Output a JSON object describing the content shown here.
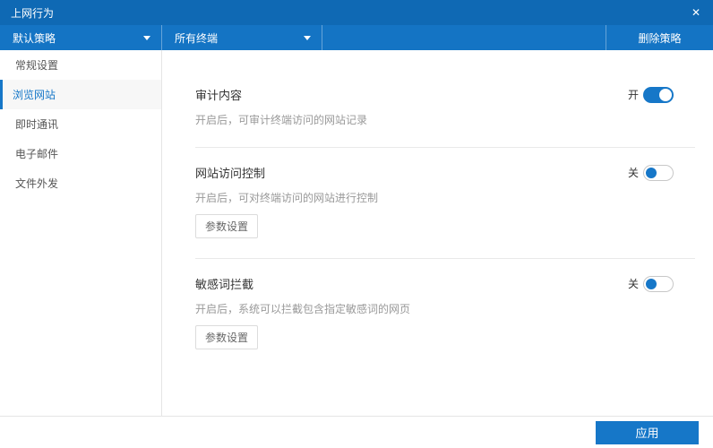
{
  "window": {
    "title": "上网行为",
    "close_icon": "✕"
  },
  "toolbar": {
    "policy_dropdown": {
      "value": "默认策略"
    },
    "terminal_dropdown": {
      "value": "所有终端"
    },
    "delete_button_label": "删除策略"
  },
  "sidebar": {
    "items": [
      {
        "label": "常规设置",
        "selected": false
      },
      {
        "label": "浏览网站",
        "selected": true
      },
      {
        "label": "即时通讯",
        "selected": false
      },
      {
        "label": "电子邮件",
        "selected": false
      },
      {
        "label": "文件外发",
        "selected": false
      }
    ]
  },
  "settings": [
    {
      "title": "审计内容",
      "description": "开启后，可审计终端访问的网站记录",
      "toggle_state_label": "开",
      "enabled": true
    },
    {
      "title": "网站访问控制",
      "description": "开启后，可对终端访问的网站进行控制",
      "toggle_state_label": "关",
      "enabled": false,
      "params_button_label": "参数设置"
    },
    {
      "title": "敏感词拦截",
      "description": "开启后，系统可以拦截包含指定敏感词的网页",
      "toggle_state_label": "关",
      "enabled": false,
      "params_button_label": "参数设置"
    }
  ],
  "footer": {
    "apply_button_label": "应用"
  },
  "colors": {
    "title_bar": "#0f69b4",
    "toolbar": "#1474c4",
    "accent": "#1677c8"
  }
}
